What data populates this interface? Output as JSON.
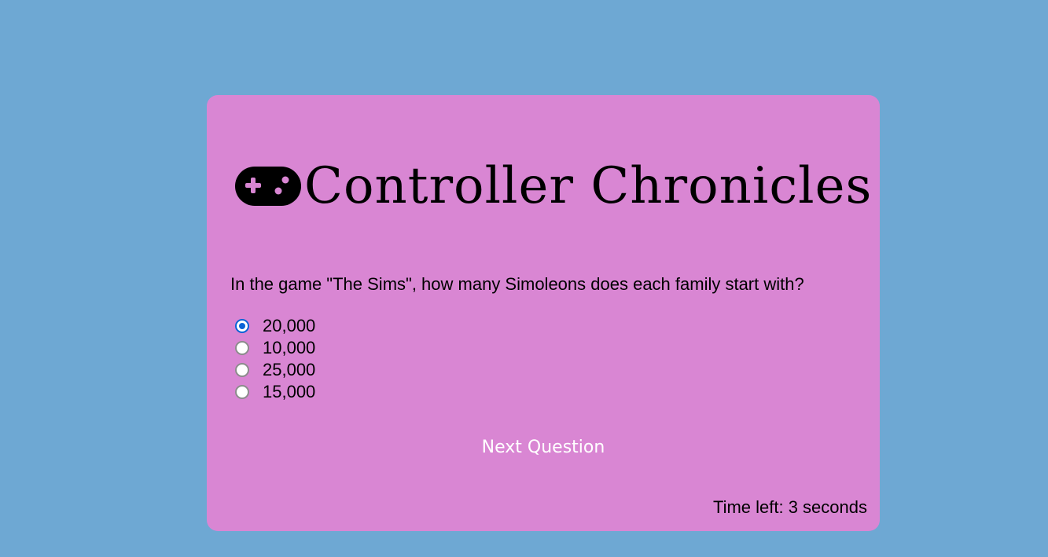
{
  "header": {
    "title": "Controller Chronicles",
    "icon": "gamepad-icon"
  },
  "quiz": {
    "question": "In the game \"The Sims\", how many Simoleons does each family start with?",
    "options": [
      {
        "label": "20,000",
        "selected": true
      },
      {
        "label": "10,000",
        "selected": false
      },
      {
        "label": "25,000",
        "selected": false
      },
      {
        "label": "15,000",
        "selected": false
      }
    ],
    "next_label": "Next Question",
    "timer_text": "Time left: 3 seconds"
  },
  "colors": {
    "background": "#6ea8d3",
    "card": "#d986d3",
    "accent": "#0a63d6"
  }
}
